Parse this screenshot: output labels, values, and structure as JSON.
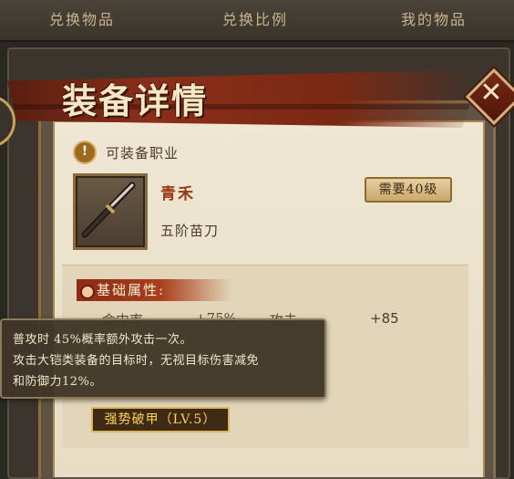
{
  "tabs": [
    {
      "label": "兑换物品"
    },
    {
      "label": "兑换比例"
    },
    {
      "label": "我的物品"
    }
  ],
  "modal": {
    "title": "装备详情",
    "close_icon": "close-x-icon",
    "job_icon": "warning-icon",
    "job_label": "可装备职业",
    "item": {
      "icon": "blade-weapon-icon",
      "name": "青禾",
      "type": "五阶苗刀",
      "level_req": "需要40级"
    },
    "attributes": {
      "title": "基础属性:",
      "partial_1": "命中率",
      "partial_2": "+75%",
      "partial_3": "攻击",
      "value": "+85"
    },
    "skill": "强势破甲（LV.5）"
  },
  "tooltip": {
    "line1": "普攻时 45%概率额外攻击一次。",
    "line2": "攻击大铠类装备的目标时，无视目标伤害减免",
    "line3": "和防御力12%。"
  },
  "colors": {
    "title_banner": "#8a2e18",
    "item_name": "#9a3a12",
    "skill_text": "#ffd54a"
  }
}
